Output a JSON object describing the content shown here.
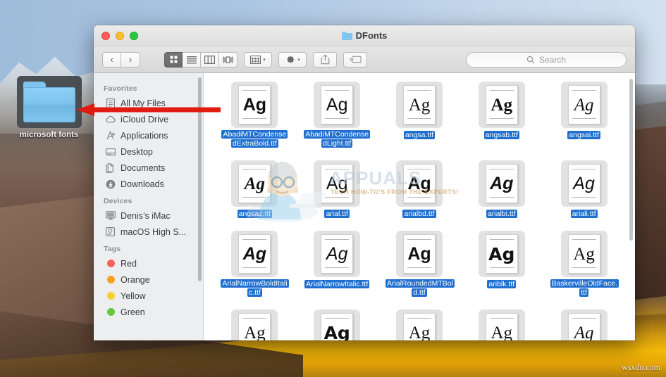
{
  "desktop": {
    "folder_icon": {
      "label": "microsoft fonts",
      "icon": "folder-icon"
    },
    "watermark_corner": "wsxdn.com",
    "arrow": {
      "icon": "red-arrow-icon",
      "direction": "left"
    }
  },
  "window": {
    "title": "DFonts",
    "title_icon": "folder-icon",
    "traffic_lights": {
      "close": "close-button",
      "minimize": "minimize-button",
      "zoom": "zoom-button"
    },
    "toolbar": {
      "back_label": "‹",
      "forward_label": "›",
      "view_icon_label": "icon-view",
      "view_list_label": "list-view",
      "view_column_label": "column-view",
      "view_coverflow_label": "coverflow-view",
      "arrange_label": "arrange-button",
      "action_label": "action-gear-button",
      "share_label": "share-button",
      "tags_label": "tags-button",
      "chevron": "▾"
    },
    "search": {
      "placeholder": "Search",
      "value": "",
      "icon": "search-icon"
    }
  },
  "sidebar": {
    "sections": [
      {
        "title": "Favorites",
        "items": [
          {
            "label": "All My Files",
            "icon": "all-my-files-icon"
          },
          {
            "label": "iCloud Drive",
            "icon": "icloud-drive-icon"
          },
          {
            "label": "Applications",
            "icon": "applications-icon"
          },
          {
            "label": "Desktop",
            "icon": "desktop-icon"
          },
          {
            "label": "Documents",
            "icon": "documents-icon"
          },
          {
            "label": "Downloads",
            "icon": "downloads-icon"
          }
        ]
      },
      {
        "title": "Devices",
        "items": [
          {
            "label": "Denis’s iMac",
            "icon": "imac-icon"
          },
          {
            "label": "macOS High S...",
            "icon": "hard-drive-icon"
          }
        ]
      },
      {
        "title": "Tags",
        "items": [
          {
            "label": "Red",
            "icon": "tag-dot-icon",
            "color": "#f9635c"
          },
          {
            "label": "Orange",
            "icon": "tag-dot-icon",
            "color": "#f9a01f"
          },
          {
            "label": "Yellow",
            "icon": "tag-dot-icon",
            "color": "#f7cf30"
          },
          {
            "label": "Green",
            "icon": "tag-dot-icon",
            "color": "#64c744"
          }
        ]
      }
    ]
  },
  "files": [
    {
      "name": "AbadiMTCondensedExtraBold.ttf",
      "style": "sans-b",
      "selected": true
    },
    {
      "name": "AbadiMTCondensedLight.ttf",
      "style": "sans",
      "selected": true
    },
    {
      "name": "angsa.ttf",
      "style": "serif",
      "selected": true
    },
    {
      "name": "angsab.ttf",
      "style": "serif-b",
      "selected": true
    },
    {
      "name": "angsai.ttf",
      "style": "serif-i",
      "selected": true
    },
    {
      "name": "angsaz.ttf",
      "style": "serif-bi",
      "selected": true
    },
    {
      "name": "arial.ttf",
      "style": "sans",
      "selected": true
    },
    {
      "name": "arialbd.ttf",
      "style": "sans-b",
      "selected": true
    },
    {
      "name": "arialbi.ttf",
      "style": "sans-bi",
      "selected": true
    },
    {
      "name": "ariali.ttf",
      "style": "sans-i",
      "selected": true
    },
    {
      "name": "ArialNarrowBoldItalic.ttf",
      "style": "sans-bi",
      "selected": true
    },
    {
      "name": "ArialNarrowItalic.ttf",
      "style": "sans-i",
      "selected": true
    },
    {
      "name": "ArialRoundedMTBold.ttf",
      "style": "sans-b",
      "selected": true
    },
    {
      "name": "ariblk.ttf",
      "style": "black",
      "selected": true
    },
    {
      "name": "BaskervilleOldFace.ttf",
      "style": "serif",
      "selected": true
    }
  ],
  "files_partial_row": [
    {
      "style": "serif"
    },
    {
      "style": "black"
    },
    {
      "style": "serif"
    },
    {
      "style": "serif"
    },
    {
      "style": "serif-i"
    }
  ],
  "watermark": {
    "brand": "APPUALS",
    "tagline": "TECH HOW-TO'S FROM THE EXPERTS!"
  },
  "colors": {
    "selection_blue": "#1f6fd0",
    "arrow_red": "#e01b10",
    "sidebar_bg": "#eceef0"
  }
}
